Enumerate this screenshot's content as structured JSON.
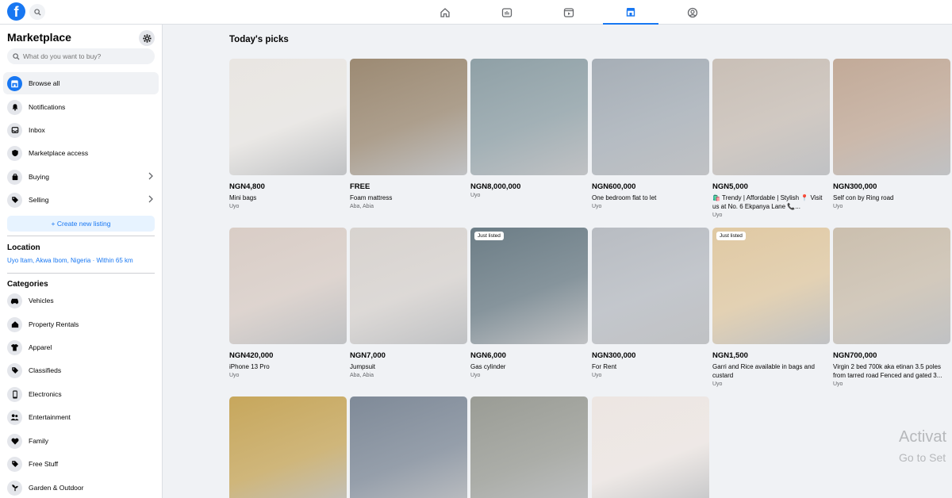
{
  "topbar": {
    "logo_letter": "f",
    "nav": [
      {
        "name": "home",
        "icon": "home-icon"
      },
      {
        "name": "watch",
        "icon": "video-icon"
      },
      {
        "name": "reels",
        "icon": "reels-icon"
      },
      {
        "name": "marketplace",
        "icon": "marketplace-icon",
        "active": true
      },
      {
        "name": "groups",
        "icon": "groups-icon"
      }
    ]
  },
  "sidebar": {
    "title": "Marketplace",
    "search_placeholder": "What do you want to buy?",
    "items": [
      {
        "label": "Browse all",
        "icon": "storefront-icon",
        "active": true
      },
      {
        "label": "Notifications",
        "icon": "bell-icon"
      },
      {
        "label": "Inbox",
        "icon": "inbox-icon"
      },
      {
        "label": "Marketplace access",
        "icon": "shield-icon"
      },
      {
        "label": "Buying",
        "icon": "bag-icon",
        "chevron": true
      },
      {
        "label": "Selling",
        "icon": "tag-icon",
        "chevron": true
      }
    ],
    "create_label": "+ Create new listing",
    "location_title": "Location",
    "location_value": "Uyo Itam, Akwa Ibom, Nigeria · Within 65 km",
    "categories_title": "Categories",
    "categories": [
      {
        "label": "Vehicles",
        "icon": "car-icon"
      },
      {
        "label": "Property Rentals",
        "icon": "house-icon"
      },
      {
        "label": "Apparel",
        "icon": "shirt-icon"
      },
      {
        "label": "Classifieds",
        "icon": "tag-icon"
      },
      {
        "label": "Electronics",
        "icon": "phone-icon"
      },
      {
        "label": "Entertainment",
        "icon": "people-icon"
      },
      {
        "label": "Family",
        "icon": "heart-icon"
      },
      {
        "label": "Free Stuff",
        "icon": "gift-tag-icon"
      },
      {
        "label": "Garden & Outdoor",
        "icon": "plant-icon"
      }
    ]
  },
  "main": {
    "title": "Today's picks",
    "listings": [
      {
        "price": "NGN4,800",
        "title": "Mini bags",
        "location": "Uyo",
        "badge": "",
        "bg": "#e9e6e2"
      },
      {
        "price": "FREE",
        "title": "Foam mattress",
        "location": "Aba, Abia",
        "badge": "",
        "bg": "#9c8a73"
      },
      {
        "price": "NGN8,000,000",
        "title": "",
        "location": "Uyo",
        "badge": "",
        "bg": "#8fa0a6"
      },
      {
        "price": "NGN600,000",
        "title": "One bedroom flat to let",
        "location": "Uyo",
        "badge": "",
        "bg": "#a6aeb6"
      },
      {
        "price": "NGN5,000",
        "title": "🛍️ Trendy | Affordable | Stylish 📍 Visit us at No. 6 Ekpanya Lane 📞...",
        "location": "Uyo",
        "badge": "",
        "bg": "#c9bfb6"
      },
      {
        "price": "NGN300,000",
        "title": "Self con by Ring road",
        "location": "Uyo",
        "badge": "",
        "bg": "#c2aa98"
      },
      {
        "price": "NGN420,000",
        "title": "iPhone 13 Pro",
        "location": "Uyo",
        "badge": "",
        "bg": "#d9cdc6"
      },
      {
        "price": "NGN7,000",
        "title": "Jumpsuit",
        "location": "Aba, Abia",
        "badge": "",
        "bg": "#d8d3cf"
      },
      {
        "price": "NGN6,000",
        "title": "Gas cylinder",
        "location": "Uyo",
        "badge": "Just listed",
        "bg": "#6c7d86"
      },
      {
        "price": "NGN300,000",
        "title": "For Rent",
        "location": "Uyo",
        "badge": "",
        "bg": "#b8bcc2"
      },
      {
        "price": "NGN1,500",
        "title": "Garri and Rice available in bags and custard",
        "location": "Uyo",
        "badge": "Just listed",
        "bg": "#e0c9a3"
      },
      {
        "price": "NGN700,000",
        "title": "Virgin 2 bed 700k aka etinan 3.5 poles from tarred road Fenced and gated 3...",
        "location": "Uyo",
        "badge": "",
        "bg": "#cbbfae"
      },
      {
        "price": "",
        "title": "",
        "location": "",
        "badge": "",
        "bg": "#c7a75c"
      },
      {
        "price": "",
        "title": "",
        "location": "",
        "badge": "",
        "bg": "#7f8a98"
      },
      {
        "price": "",
        "title": "",
        "location": "",
        "badge": "",
        "bg": "#9a9c95"
      },
      {
        "price": "",
        "title": "",
        "location": "",
        "badge": "",
        "bg": "#ede6e2"
      }
    ]
  },
  "watermark": {
    "line1": "Activat",
    "line2": "Go to Set"
  }
}
